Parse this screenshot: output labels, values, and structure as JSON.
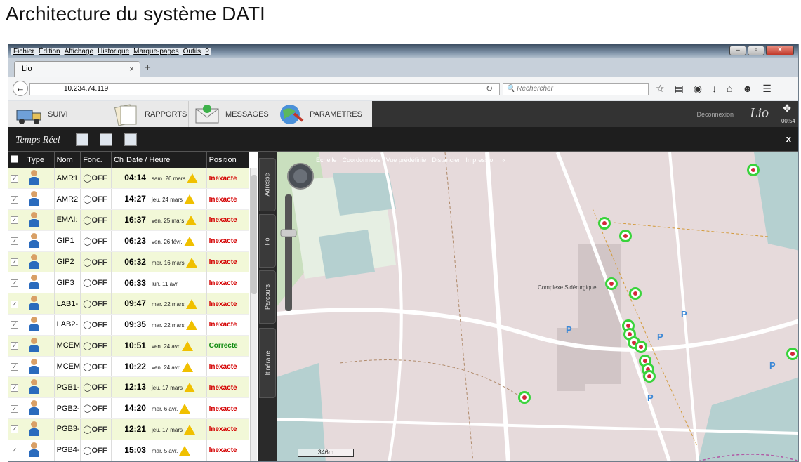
{
  "page_title": "Architecture du système DATI",
  "browser": {
    "menu": [
      "Fichier",
      "Édition",
      "Affichage",
      "Historique",
      "Marque-pages",
      "Outils",
      "?"
    ],
    "tab_title": "Lio",
    "tab_close": "×",
    "new_tab": "+",
    "url": "10.234.74.119",
    "search_placeholder": "Rechercher",
    "window_buttons": [
      "‒",
      "▫",
      "✕"
    ]
  },
  "app": {
    "menu_tabs": [
      {
        "label": "SUIVI",
        "icon": "truck-icon"
      },
      {
        "label": "RAPPORTS",
        "icon": "documents-icon"
      },
      {
        "label": "MESSAGES",
        "icon": "envelope-icon"
      },
      {
        "label": "PARAMETRES",
        "icon": "globe-tools-icon"
      }
    ],
    "logout": "Déconnexion",
    "brand": "Lio",
    "clock": "00:54",
    "section": "Temps Réel",
    "close": "x"
  },
  "table": {
    "columns": [
      "",
      "Type",
      "Nom",
      "Fonc.",
      "Ch",
      "Date / Heure",
      "Position"
    ],
    "rows": [
      {
        "nom": "AMR1",
        "fonc": "OFF",
        "time": "04:14",
        "date": "sam. 26 mars",
        "warn": true,
        "position": "Inexacte",
        "ok": false
      },
      {
        "nom": "AMR2",
        "fonc": "OFF",
        "time": "14:27",
        "date": "jeu. 24 mars",
        "warn": true,
        "position": "Inexacte",
        "ok": false
      },
      {
        "nom": "EMAI:",
        "fonc": "OFF",
        "time": "16:37",
        "date": "ven. 25 mars",
        "warn": true,
        "position": "Inexacte",
        "ok": false
      },
      {
        "nom": "GIP1",
        "fonc": "OFF",
        "time": "06:23",
        "date": "ven. 26 févr.",
        "warn": true,
        "position": "Inexacte",
        "ok": false
      },
      {
        "nom": "GIP2",
        "fonc": "OFF",
        "time": "06:32",
        "date": "mer. 16 mars",
        "warn": true,
        "position": "Inexacte",
        "ok": false
      },
      {
        "nom": "GIP3",
        "fonc": "OFF",
        "time": "06:33",
        "date": "lun. 11 avr.",
        "warn": false,
        "position": "Inexacte",
        "ok": false
      },
      {
        "nom": "LAB1-",
        "fonc": "OFF",
        "time": "09:47",
        "date": "mar. 22 mars",
        "warn": true,
        "position": "Inexacte",
        "ok": false
      },
      {
        "nom": "LAB2-",
        "fonc": "OFF",
        "time": "09:35",
        "date": "mar. 22 mars",
        "warn": true,
        "position": "Inexacte",
        "ok": false
      },
      {
        "nom": "MCEM",
        "fonc": "OFF",
        "time": "10:51",
        "date": "ven. 24 avr.",
        "warn": true,
        "position": "Correcte",
        "ok": true
      },
      {
        "nom": "MCEM",
        "fonc": "OFF",
        "time": "10:22",
        "date": "ven. 24 avr.",
        "warn": true,
        "position": "Inexacte",
        "ok": false
      },
      {
        "nom": "PGB1-",
        "fonc": "OFF",
        "time": "12:13",
        "date": "jeu. 17 mars",
        "warn": true,
        "position": "Inexacte",
        "ok": false
      },
      {
        "nom": "PGB2-",
        "fonc": "OFF",
        "time": "14:20",
        "date": "mer. 6 avr.",
        "warn": true,
        "position": "Inexacte",
        "ok": false
      },
      {
        "nom": "PGB3-",
        "fonc": "OFF",
        "time": "12:21",
        "date": "jeu. 17 mars",
        "warn": true,
        "position": "Inexacte",
        "ok": false
      },
      {
        "nom": "PGB4-",
        "fonc": "OFF",
        "time": "15:03",
        "date": "mar. 5 avr.",
        "warn": true,
        "position": "Inexacte",
        "ok": false
      }
    ]
  },
  "side_tabs": [
    "Adresse",
    "Poi",
    "Parcours",
    "Itinéraire"
  ],
  "map": {
    "toolbar": [
      "Echelle",
      "Coordonnées",
      "Vue prédéfinie",
      "Distancier",
      "Impression"
    ],
    "collapse": "«",
    "label_complexe": "Complexe Sidérurgique",
    "scale": "346m",
    "parking": "P"
  }
}
